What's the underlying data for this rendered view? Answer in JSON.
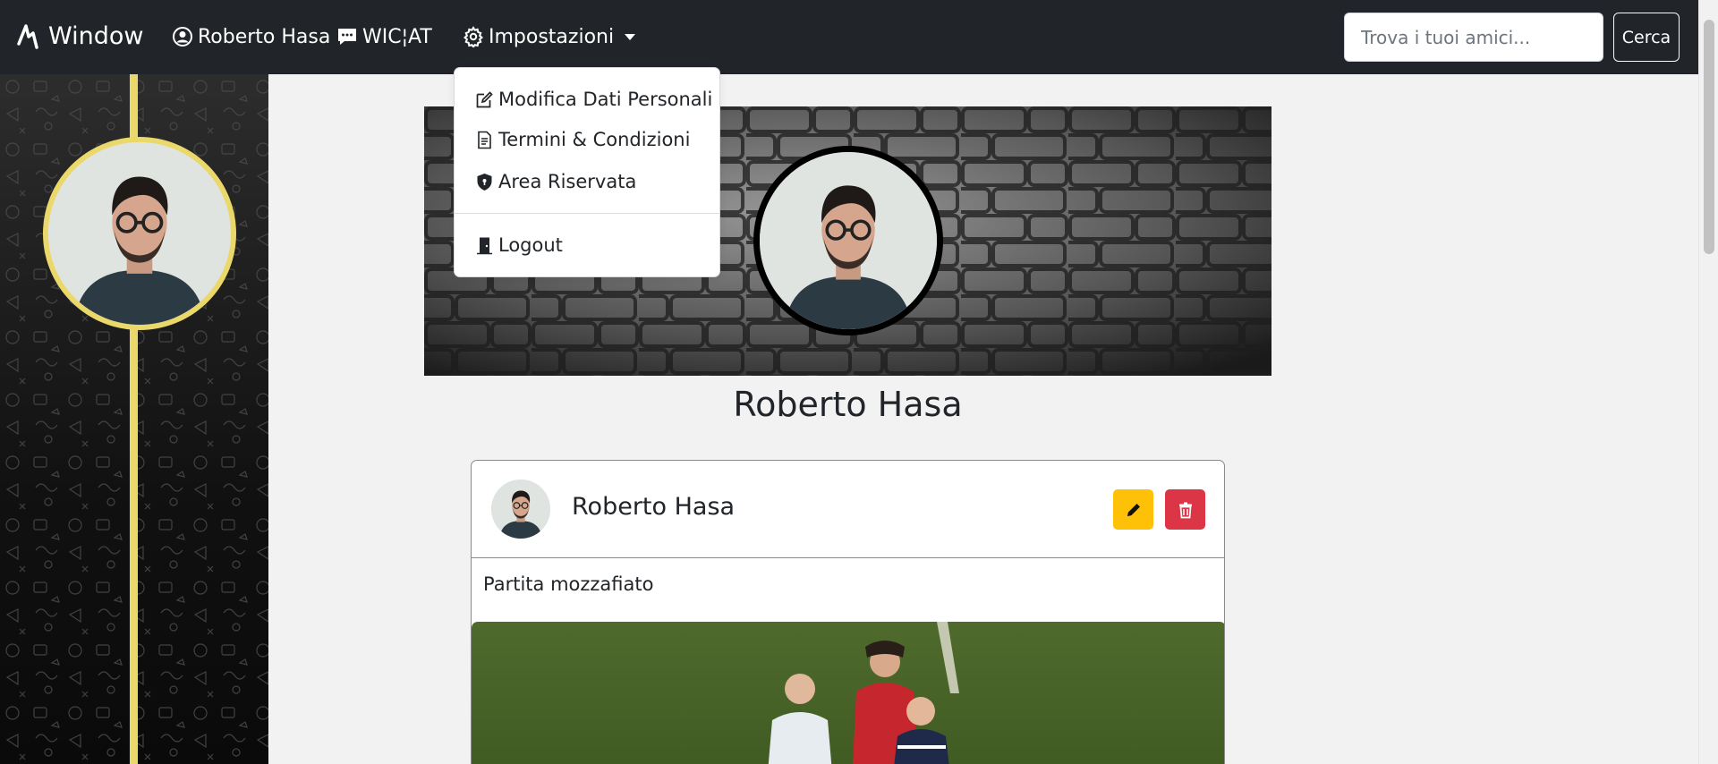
{
  "navbar": {
    "brand": "Window",
    "profile_label": "Roberto Hasa",
    "chat_label": "WIC¦AT",
    "settings_label": "Impostazioni",
    "search_placeholder": "Trova i tuoi amici...",
    "search_button": "Cerca"
  },
  "dropdown": {
    "items": [
      {
        "label": "Modifica Dati Personali",
        "icon": "edit-icon"
      },
      {
        "label": "Termini & Condizioni",
        "icon": "document-icon"
      },
      {
        "label": "Area Riservata",
        "icon": "shield-lock-icon"
      },
      {
        "label": "Logout",
        "icon": "door-icon"
      }
    ]
  },
  "profile": {
    "name": "Roberto Hasa"
  },
  "post": {
    "author": "Roberto Hasa",
    "text": "Partita mozzafiato"
  },
  "colors": {
    "navbar": "#212529",
    "accent_yellow": "#ebd86a",
    "edit_button": "#ffc107",
    "delete_button": "#dc3545"
  }
}
